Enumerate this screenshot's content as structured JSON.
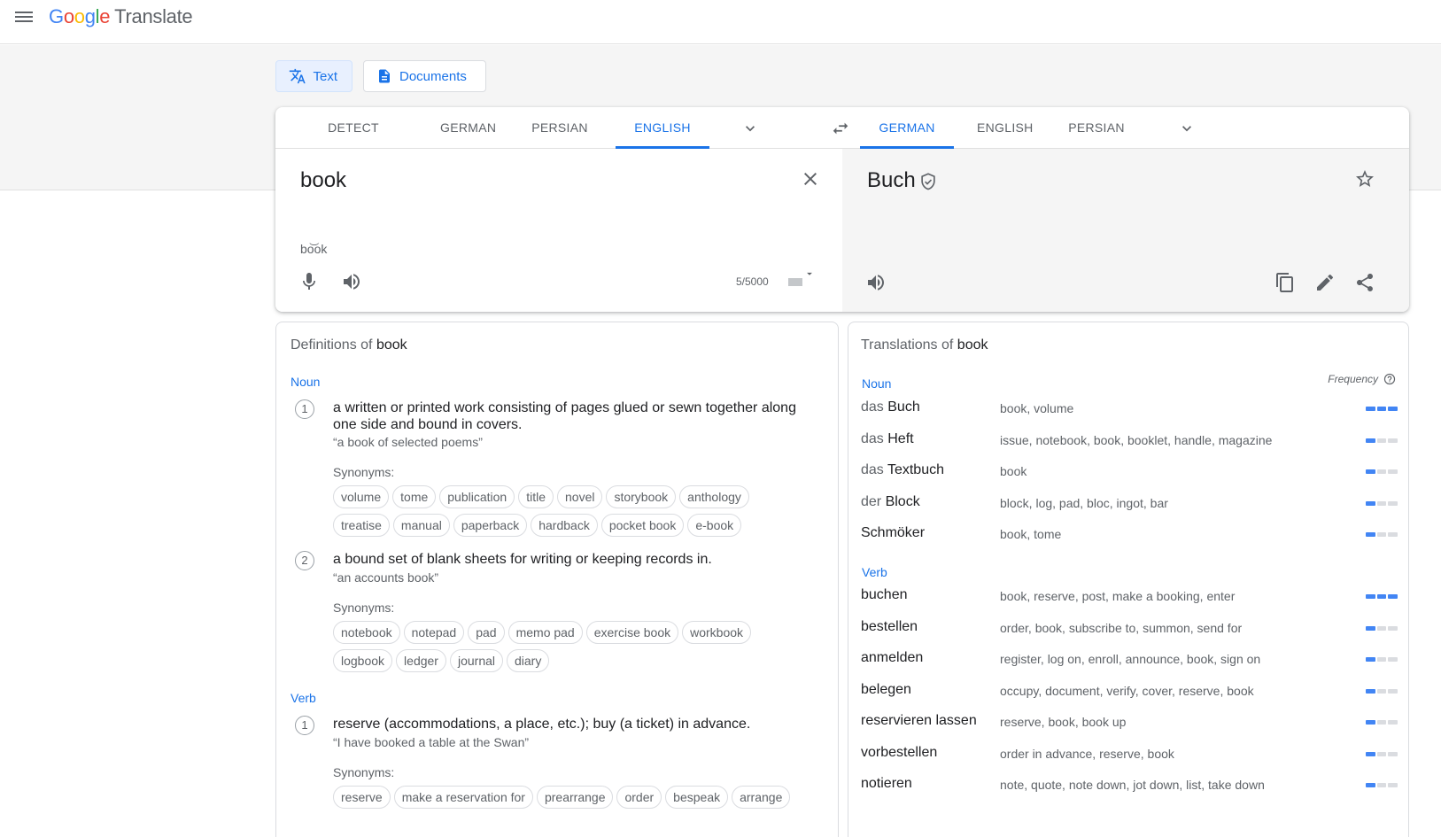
{
  "app": {
    "logo_letters": [
      "G",
      "o",
      "o",
      "g",
      "l",
      "e"
    ],
    "product": "Translate"
  },
  "modes": {
    "text": "Text",
    "documents": "Documents"
  },
  "source_langs": [
    "DETECT LANGUAGE",
    "GERMAN",
    "PERSIAN",
    "ENGLISH"
  ],
  "target_langs": [
    "GERMAN",
    "ENGLISH",
    "PERSIAN"
  ],
  "source": {
    "text": "book",
    "transliteration": "bo͝ok",
    "char_count": "5/5000"
  },
  "target": {
    "text": "Buch"
  },
  "definitions": {
    "title_prefix": "Definitions of",
    "word": "book",
    "noun_label": "Noun",
    "verb_label": "Verb",
    "synonyms_label": "Synonyms:",
    "items": [
      {
        "num": "1",
        "text": "a written or printed work consisting of pages glued or sewn together along one side and bound in covers.",
        "example": "“a book of selected poems”",
        "synonyms": [
          "volume",
          "tome",
          "publication",
          "title",
          "novel",
          "storybook",
          "anthology",
          "treatise",
          "manual",
          "paperback",
          "hardback",
          "pocket book",
          "e-book"
        ]
      },
      {
        "num": "2",
        "text": "a bound set of blank sheets for writing or keeping records in.",
        "example": "“an accounts book”",
        "synonyms": [
          "notebook",
          "notepad",
          "pad",
          "memo pad",
          "exercise book",
          "workbook",
          "logbook",
          "ledger",
          "journal",
          "diary"
        ]
      },
      {
        "num": "1",
        "text": "reserve (accommodations, a place, etc.); buy (a ticket) in advance.",
        "example": "“I have booked a table at the Swan”",
        "synonyms": [
          "reserve",
          "make a reservation for",
          "prearrange",
          "order",
          "bespeak",
          "arrange"
        ]
      }
    ]
  },
  "translations": {
    "title_prefix": "Translations of",
    "word": "book",
    "frequency_label": "Frequency",
    "noun_label": "Noun",
    "verb_label": "Verb",
    "noun_rows": [
      {
        "article": "das",
        "word": "Buch",
        "synonyms": "book, volume",
        "freq": 3
      },
      {
        "article": "das",
        "word": "Heft",
        "synonyms": "issue, notebook, book, booklet, handle, magazine",
        "freq": 1
      },
      {
        "article": "das",
        "word": "Textbuch",
        "synonyms": "book",
        "freq": 1
      },
      {
        "article": "der",
        "word": "Block",
        "synonyms": "block, log, pad, bloc, ingot, bar",
        "freq": 1
      },
      {
        "article": "",
        "word": "Schmöker",
        "synonyms": "book, tome",
        "freq": 1
      }
    ],
    "verb_rows": [
      {
        "article": "",
        "word": "buchen",
        "synonyms": "book, reserve, post, make a booking, enter",
        "freq": 3
      },
      {
        "article": "",
        "word": "bestellen",
        "synonyms": "order, book, subscribe to, summon, send for",
        "freq": 1
      },
      {
        "article": "",
        "word": "anmelden",
        "synonyms": "register, log on, enroll, announce, book, sign on",
        "freq": 1
      },
      {
        "article": "",
        "word": "belegen",
        "synonyms": "occupy, document, verify, cover, reserve, book",
        "freq": 1
      },
      {
        "article": "",
        "word": "reservieren lassen",
        "synonyms": "reserve, book, book up",
        "freq": 1
      },
      {
        "article": "",
        "word": "vorbestellen",
        "synonyms": "order in advance, reserve, book",
        "freq": 1
      },
      {
        "article": "",
        "word": "notieren",
        "synonyms": "note, quote, note down, jot down, list, take down",
        "freq": 1
      }
    ]
  },
  "colors": {
    "accent": "#1a73e8",
    "freq_on": "#4285f4",
    "freq_off": "#dadce0"
  }
}
